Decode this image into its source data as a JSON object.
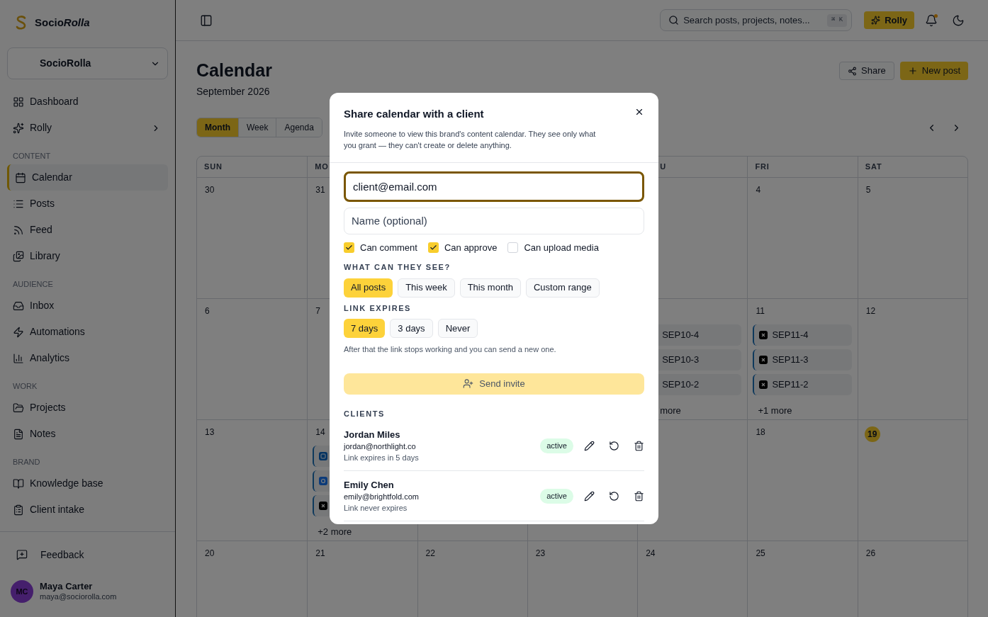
{
  "sidebar": {
    "brand": [
      "Socio",
      "Rolla"
    ],
    "workspace": "SocioRolla",
    "groups": [
      {
        "items": [
          {
            "label": "Dashboard",
            "selected": false,
            "submenu": false
          },
          {
            "label": "Rolly",
            "selected": false,
            "submenu": true
          }
        ]
      },
      {
        "heading": "CONTENT",
        "items": [
          {
            "label": "Calendar",
            "selected": true,
            "submenu": false
          },
          {
            "label": "Posts",
            "selected": false,
            "submenu": false
          },
          {
            "label": "Feed",
            "selected": false,
            "submenu": false
          },
          {
            "label": "Library",
            "selected": false,
            "submenu": false
          }
        ]
      },
      {
        "heading": "AUDIENCE",
        "items": [
          {
            "label": "Inbox",
            "selected": false,
            "submenu": false
          },
          {
            "label": "Automations",
            "selected": false,
            "submenu": false
          },
          {
            "label": "Analytics",
            "selected": false,
            "submenu": false
          }
        ]
      },
      {
        "heading": "WORK",
        "items": [
          {
            "label": "Projects",
            "selected": false,
            "submenu": false
          },
          {
            "label": "Notes",
            "selected": false,
            "submenu": false
          }
        ]
      },
      {
        "heading": "BRAND",
        "items": [
          {
            "label": "Knowledge base",
            "selected": false,
            "submenu": false
          },
          {
            "label": "Client intake",
            "selected": false,
            "submenu": false
          }
        ]
      }
    ],
    "feedback": "Feedback",
    "user": {
      "initials": "MC",
      "name": "Maya Carter",
      "email": "maya@sociorolla.com"
    }
  },
  "topbar": {
    "search_placeholder": "Search posts, projects, notes...",
    "shortcut": "⌘ K",
    "assistant": "Rolly",
    "notification_dot": true
  },
  "page": {
    "title": "Calendar",
    "subtitle": "September 2026",
    "actions": [
      {
        "kind": "share",
        "label": "Share"
      },
      {
        "kind": "new",
        "label": "New post"
      }
    ],
    "views": [
      {
        "label": "Month",
        "selected": true
      },
      {
        "label": "Week",
        "selected": false
      },
      {
        "label": "Agenda",
        "selected": false
      }
    ]
  },
  "calendar": {
    "weekdays": {
      "left": [
        "SUN",
        "MO"
      ],
      "right": [
        "U",
        "FRI",
        "SAT"
      ]
    },
    "weeks": [
      {
        "left": [
          {
            "date": "30",
            "today": false
          },
          {
            "date": "31",
            "today": false
          }
        ],
        "right": [
          {
            "date": "4",
            "today": false
          },
          {
            "date": "5",
            "today": false
          }
        ]
      },
      {
        "left": [
          {
            "date": "6",
            "today": false
          },
          {
            "date": "7",
            "today": false
          }
        ],
        "right": [
          {
            "posts": [
              {
                "label": "SEP10-4"
              },
              {
                "label": "SEP10-3"
              },
              {
                "label": "SEP10-2"
              }
            ],
            "more": "more"
          },
          {
            "date": "11",
            "today": false,
            "posts": [
              {
                "kind": "x",
                "label": "SEP11-4"
              },
              {
                "kind": "x",
                "label": "SEP11-3"
              },
              {
                "kind": "x",
                "label": "SEP11-2"
              }
            ],
            "more": "+1 more"
          },
          {
            "date": "12",
            "today": false
          }
        ]
      },
      {
        "left": [
          {
            "date": "13",
            "today": false
          },
          {
            "date": "14",
            "today": false,
            "posts": [
              {
                "kind": "linkedin"
              },
              {
                "kind": "facebook"
              },
              {
                "kind": "x"
              }
            ],
            "more": "+2 more"
          }
        ],
        "right": [
          {
            "date": "18",
            "today": false
          },
          {
            "date": "19",
            "today": true
          }
        ]
      },
      {
        "left": [
          {
            "date": "20",
            "today": false
          },
          {
            "date": "21",
            "today": false
          },
          {
            "date": "22",
            "today": false
          },
          {
            "date": "23",
            "today": false
          },
          {
            "date": "24",
            "today": false
          },
          {
            "date": "25",
            "today": false
          },
          {
            "date": "26",
            "today": false
          }
        ]
      }
    ]
  },
  "modal": {
    "title": "Share calendar with a client",
    "description": "Invite someone to view this brand's content calendar. They see only what you grant — they can't create or delete anything.",
    "fields": [
      {
        "value": "client@email.com",
        "focused": true
      },
      {
        "placeholder": "Name (optional)",
        "focused": false
      }
    ],
    "permissions": [
      {
        "label": "Can comment",
        "checked": true
      },
      {
        "label": "Can approve",
        "checked": true
      },
      {
        "label": "Can upload media",
        "checked": false
      }
    ],
    "scope_heading": "WHAT CAN THEY SEE?",
    "scope_options": [
      {
        "label": "All posts",
        "selected": true
      },
      {
        "label": "This week",
        "selected": false
      },
      {
        "label": "This month",
        "selected": false
      },
      {
        "label": "Custom range",
        "selected": false
      }
    ],
    "expiry_heading": "LINK EXPIRES",
    "expiry_options": [
      {
        "label": "7 days",
        "selected": true
      },
      {
        "label": "3 days",
        "selected": false
      },
      {
        "label": "Never",
        "selected": false
      }
    ],
    "expiry_note": "After that the link stops working and you can send a new one.",
    "send_button": {
      "label": "Send invite",
      "disabled": true
    },
    "clients_heading": "CLIENTS",
    "clients": [
      {
        "name": "Jordan Miles",
        "email": "jordan@northlight.co",
        "expiry": "Link expires in 5 days",
        "status": "active"
      },
      {
        "name": "Emily Chen",
        "email": "emily@brightfold.com",
        "expiry": "Link never expires",
        "status": "active"
      }
    ]
  }
}
